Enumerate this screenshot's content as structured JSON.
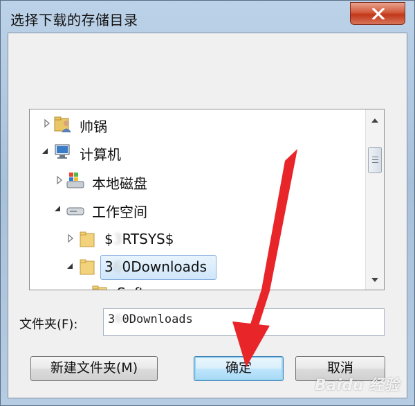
{
  "window": {
    "title": "选择下载的存储目录",
    "close_icon": "close-x-icon"
  },
  "tree": {
    "items": [
      {
        "label": "帅锅",
        "icon": "user-folder-icon",
        "expander": "collapsed"
      },
      {
        "label": "计算机",
        "icon": "computer-icon",
        "expander": "expanded"
      },
      {
        "label": "本地磁盘",
        "icon": "windows-drive-icon",
        "expander": "collapsed"
      },
      {
        "label": "工作空间",
        "icon": "drive-icon",
        "expander": "expanded"
      },
      {
        "label_prefix": "$",
        "label_blurred": "3",
        "label_suffix": "RTSYS$",
        "icon": "folder-icon",
        "expander": "collapsed"
      },
      {
        "label_prefix": "3",
        "label_blurred": "6",
        "label_suffix": "0Downloads",
        "icon": "folder-icon",
        "expander": "expanded",
        "selected": true
      },
      {
        "label": "Soft",
        "icon": "folder-icon",
        "expander": "none"
      }
    ]
  },
  "folder_field": {
    "label": "文件夹(F):",
    "value_prefix": "3",
    "value_blurred": "6",
    "value_suffix": "0Downloads"
  },
  "buttons": {
    "new_folder": "新建文件夹(M)",
    "ok": "确定",
    "cancel": "取消"
  },
  "watermark": {
    "text": "Baidu 经验"
  },
  "colors": {
    "annotation_arrow": "#e8262a",
    "selection": "#cfe6fa",
    "close_button": "#c2371a"
  }
}
